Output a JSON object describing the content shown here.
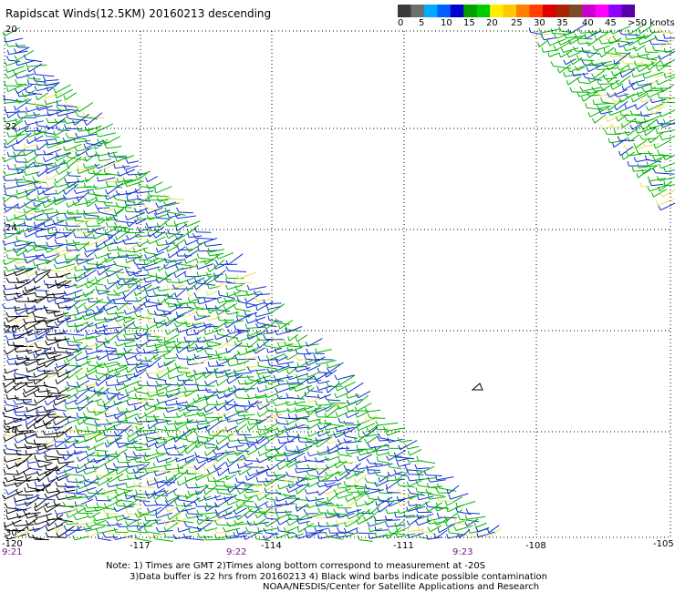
{
  "title": "Rapidscat Winds(12.5KM) 20160213 descending",
  "scale": {
    "colors": [
      "#3a3a3a",
      "#6e6e6e",
      "#00aaff",
      "#0060ff",
      "#0000cc",
      "#00a000",
      "#00cc00",
      "#ffee00",
      "#ffc800",
      "#ff8000",
      "#ff4000",
      "#dd0000",
      "#aa2200",
      "#7a4a2a",
      "#cc00cc",
      "#ff00ff",
      "#9000ff",
      "#5a00aa"
    ],
    "labels": [
      "0",
      "5",
      "10",
      "15",
      "20",
      "25",
      "30",
      "35",
      "40",
      "45",
      ">50 knots"
    ]
  },
  "map": {
    "lat_labels": [
      "20",
      "22",
      "24",
      "26",
      "28",
      "30"
    ],
    "lon_labels": [
      "-120",
      "-117",
      "-114",
      "-111",
      "-108",
      "-105"
    ],
    "times": [
      "9:21",
      "9:22",
      "9:23"
    ]
  },
  "notes": {
    "line1": "Note: 1) Times are GMT 2)Times along bottom correspond to measurement at -20S",
    "line2": "3)Data buffer is 22 hrs from 20160213 4) Black wind barbs indicate possible contamination",
    "line3": "NOAA/NESDIS/Center for Satellite Applications and Research"
  }
}
